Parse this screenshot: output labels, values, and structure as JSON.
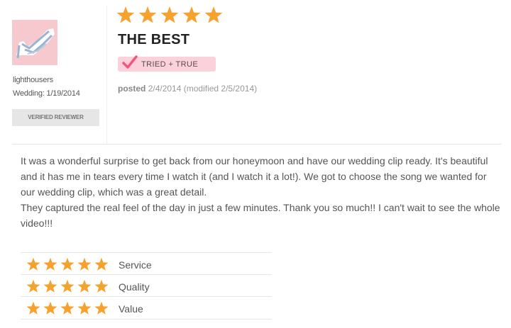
{
  "reviewer": {
    "username": "lighthousers",
    "wedding": "Wedding: 1/19/2014",
    "verified_label": "VERIFIED REVIEWER"
  },
  "review": {
    "overall_rating": 5,
    "max_rating": 5,
    "title": "THE BEST",
    "badge": "TRIED + TRUE",
    "posted_label": "posted",
    "posted_date": "2/4/2014 (modified 2/5/2014)",
    "body": [
      "It was a wonderful surprise to get back from our honeymoon and have our wedding clip ready. It's beautiful and it has me in tears every time I watch it (and I watch it a lot!). We got to choose the song we wanted for our wedding clip, which was a great detail.",
      "They captured the real feel of the day in just a few minutes. Thank you so much!! I can't wait to see the whole video!!!"
    ]
  },
  "ratings": [
    {
      "label": "Service",
      "value": 5
    },
    {
      "label": "Quality",
      "value": 5
    },
    {
      "label": "Value",
      "value": 5
    }
  ],
  "colors": {
    "star": "#f6a22f",
    "badge_bg": "#fbd2dc",
    "check": "#f0577e",
    "verified_bg": "#e6e6e6"
  },
  "icons": {
    "star": "star-icon",
    "check": "checkmark-icon",
    "avatar": "wedding-shoe-avatar"
  }
}
